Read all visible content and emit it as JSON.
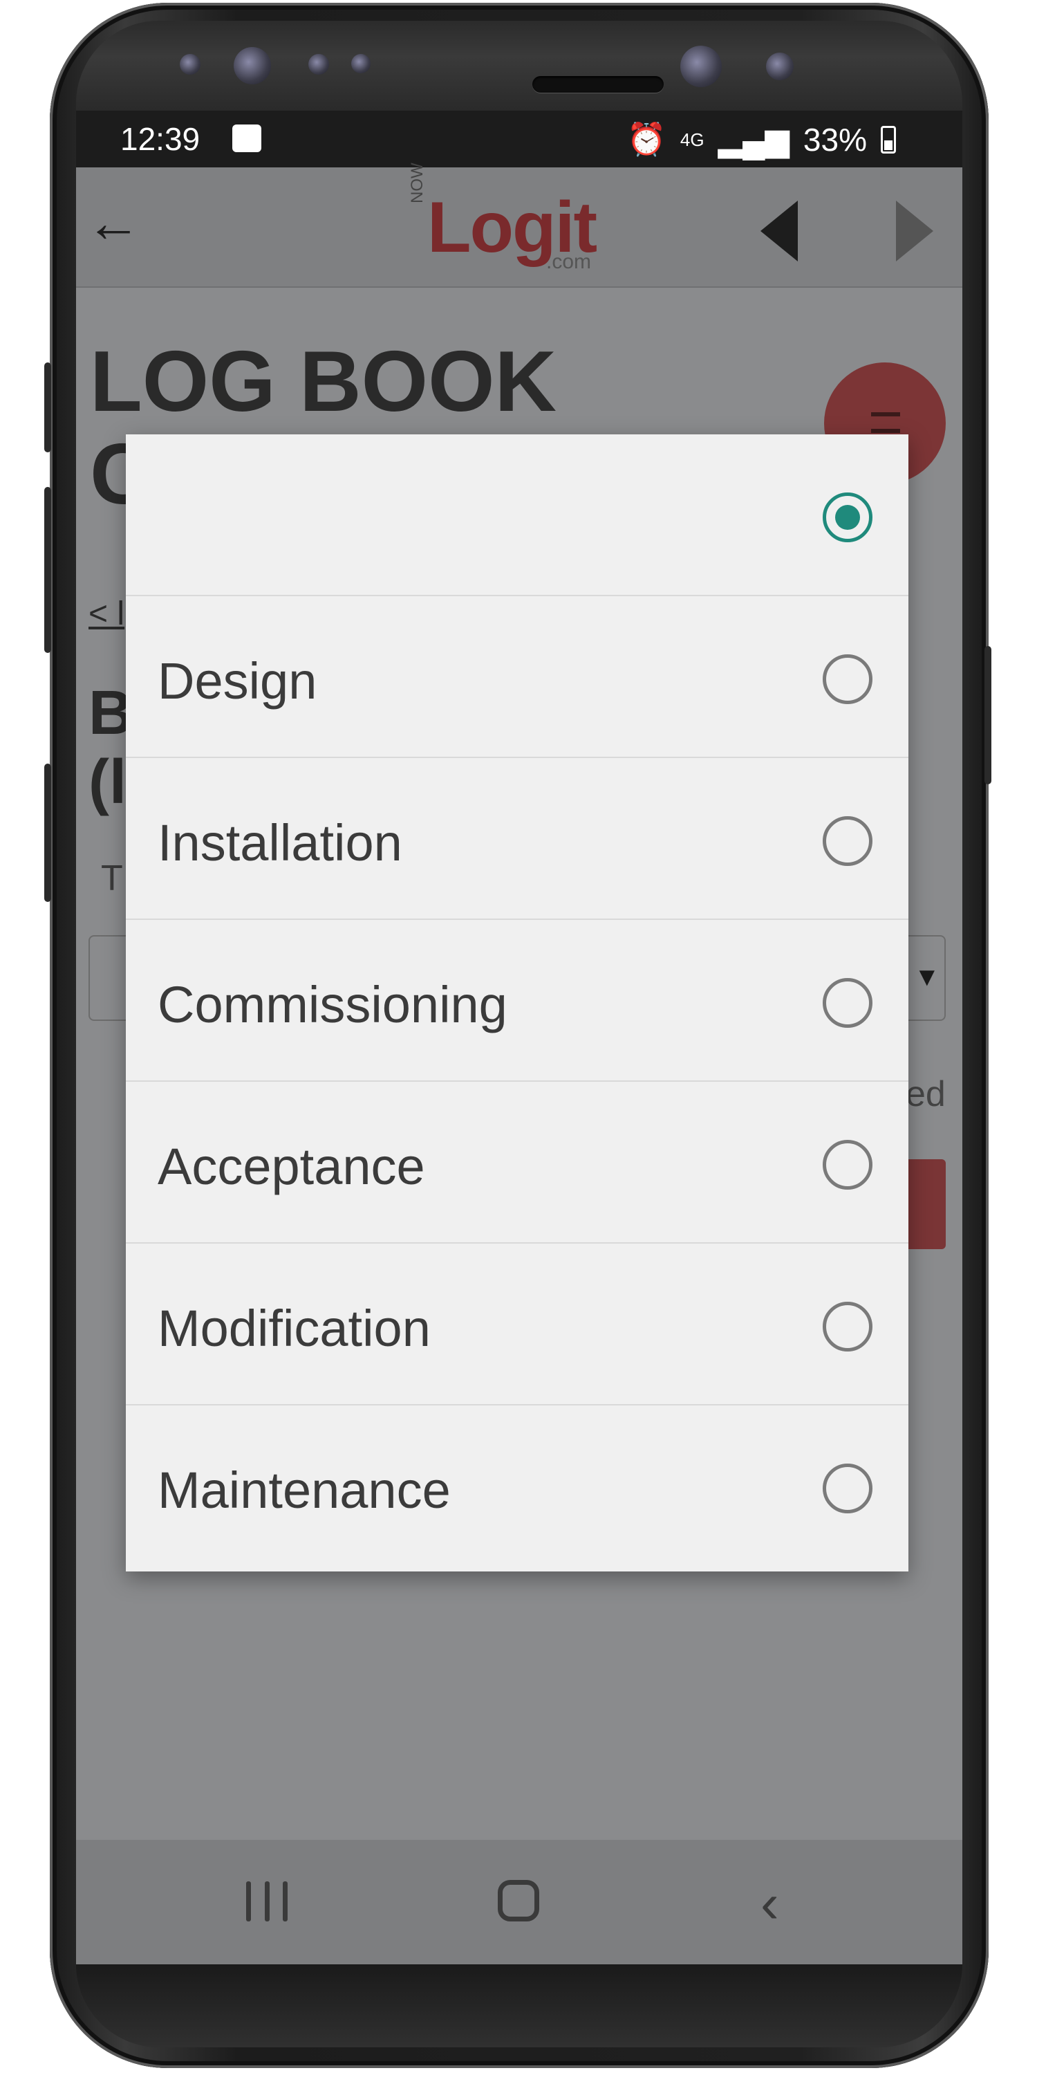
{
  "status_bar": {
    "time": "12:39",
    "network": "4G",
    "battery": "33%",
    "icons": [
      "wifi-icon",
      "alarm-icon",
      "signal-icon",
      "battery-icon"
    ]
  },
  "app_bar": {
    "logo_now": "NOW",
    "logo_main": "Logit",
    "logo_com": ".com",
    "icons": [
      "back-arrow-icon",
      "previous-icon",
      "next-icon"
    ]
  },
  "background_page": {
    "title_line1": "LOG BOOK",
    "title_line2": "C",
    "link_fragment": "< l",
    "heading_fragment1": "B",
    "heading_fragment2": "(l",
    "field_label_fragment": "T",
    "trailing_fragment": "ed",
    "fab_icon": "menu-icon"
  },
  "dialog": {
    "selected_index": 0,
    "options": [
      {
        "label": ""
      },
      {
        "label": "Design"
      },
      {
        "label": "Installation"
      },
      {
        "label": "Commissioning"
      },
      {
        "label": "Acceptance"
      },
      {
        "label": "Modification"
      },
      {
        "label": "Maintenance"
      }
    ]
  },
  "colors": {
    "accent": "#1f8a7c",
    "brand": "#7a2a2c",
    "scrim": "#8a8b8d"
  }
}
